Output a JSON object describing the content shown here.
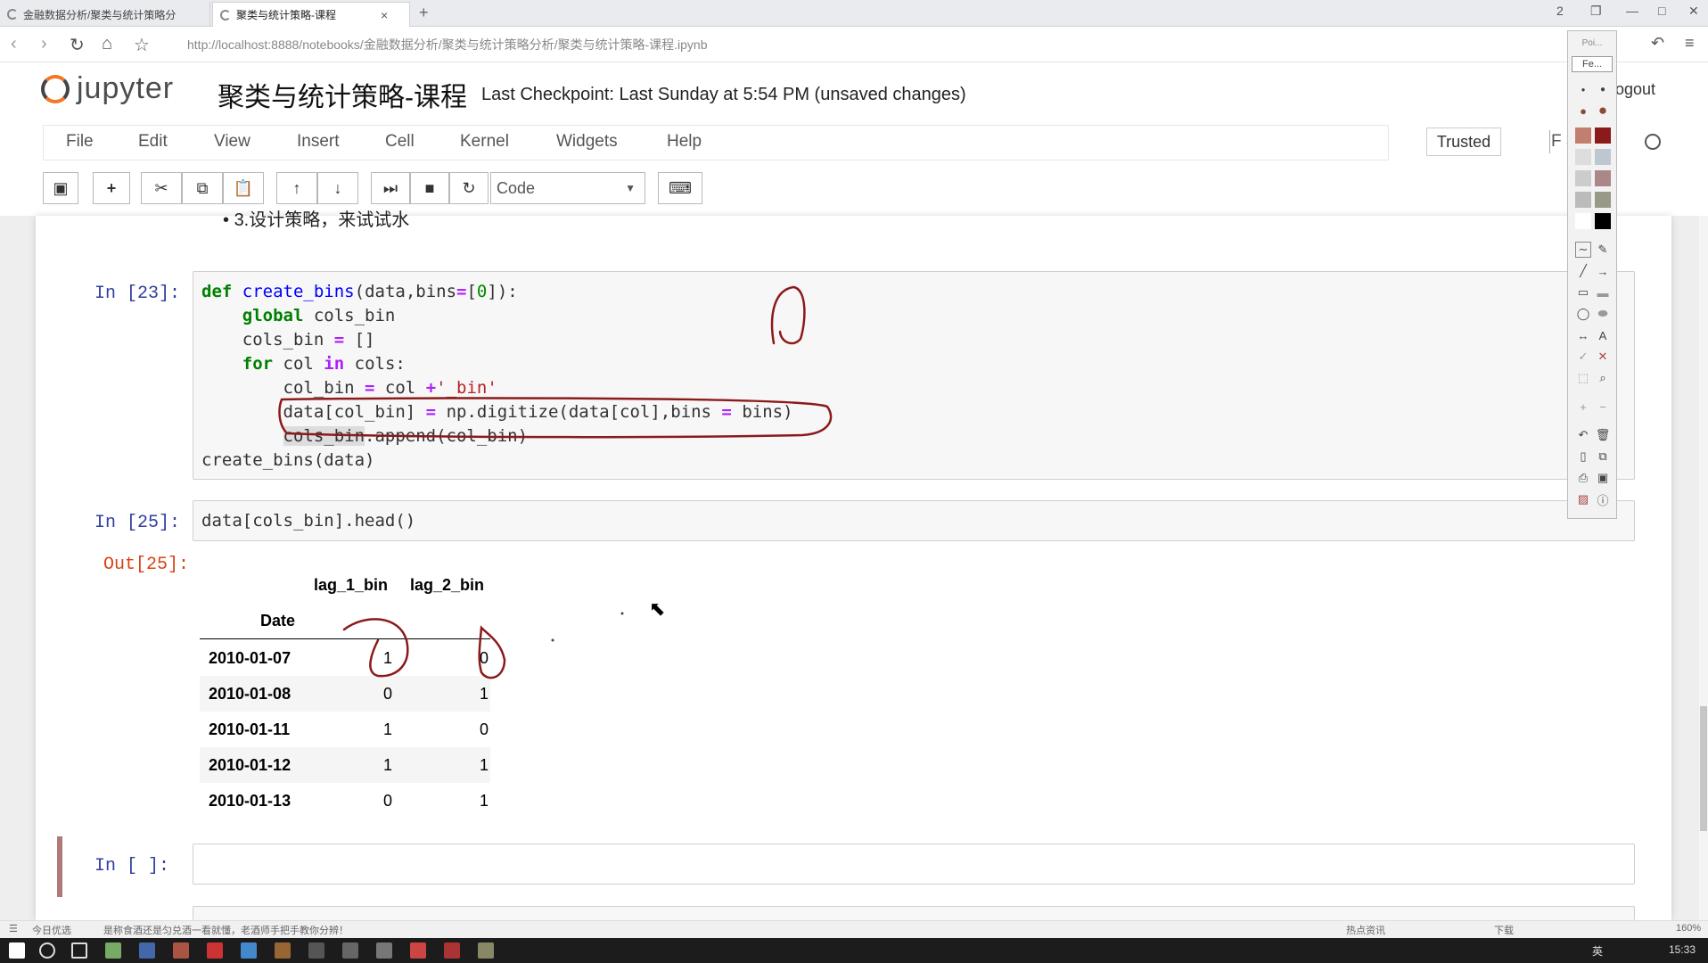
{
  "browser": {
    "tabs": [
      "金融数据分析/聚类与统计策略分",
      "聚类与统计策略-课程"
    ],
    "new_tab": "+",
    "url": "http://localhost:8888/notebooks/金融数据分析/聚类与统计策略分析/聚类与统计策略-课程.ipynb",
    "window_controls": [
      "2",
      "❐",
      "—",
      "□",
      "✕"
    ]
  },
  "jupyter": {
    "logo_text": "jupyter",
    "notebook_title": "聚类与统计策略-课程",
    "checkpoint": "Last Checkpoint: Last Sunday at 5:54 PM (unsaved changes)",
    "logout": "ogout",
    "trusted": "Trusted",
    "kernel_name": "F   3",
    "menu": [
      "File",
      "Edit",
      "View",
      "Insert",
      "Cell",
      "Kernel",
      "Widgets",
      "Help"
    ],
    "cell_type": "Code",
    "brand_color": "#f37726"
  },
  "notebook": {
    "bullet_text": "3.设计策略，来试试水",
    "cell1": {
      "prompt": "In  [23]:",
      "lines": [
        "def create_bins(data,bins=[0]):",
        "    global cols_bin",
        "    cols_bin = []",
        "    for col in cols:",
        "        col_bin = col +'_bin'",
        "        data[col_bin] = np.digitize(data[col],bins = bins)",
        "        cols_bin.append(col_bin)",
        "create_bins(data)"
      ]
    },
    "cell2": {
      "prompt": "In  [25]:",
      "code": "data[cols_bin].head()",
      "out_prompt": "Out[25]:"
    },
    "dataframe": {
      "columns": [
        "lag_1_bin",
        "lag_2_bin"
      ],
      "index_name": "Date",
      "rows": [
        {
          "date": "2010-01-07",
          "lag_1_bin": "1",
          "lag_2_bin": "0"
        },
        {
          "date": "2010-01-08",
          "lag_1_bin": "0",
          "lag_2_bin": "1"
        },
        {
          "date": "2010-01-11",
          "lag_1_bin": "1",
          "lag_2_bin": "0"
        },
        {
          "date": "2010-01-12",
          "lag_1_bin": "1",
          "lag_2_bin": "1"
        },
        {
          "date": "2010-01-13",
          "lag_1_bin": "0",
          "lag_2_bin": "1"
        }
      ]
    },
    "cell3": {
      "prompt": "In  [ ]:"
    }
  },
  "palette": {
    "header_top": "Poi...",
    "header_tab": "Fe..."
  },
  "statusbar": {
    "left": "今日优选",
    "message": "是称食酒还是匀兑酒一看就懂，老酒师手把手教你分辨！",
    "right1": "热点资讯",
    "right2": "下载",
    "zoom": "160%"
  },
  "taskbar": {
    "time": "15:33",
    "ime": "英"
  }
}
